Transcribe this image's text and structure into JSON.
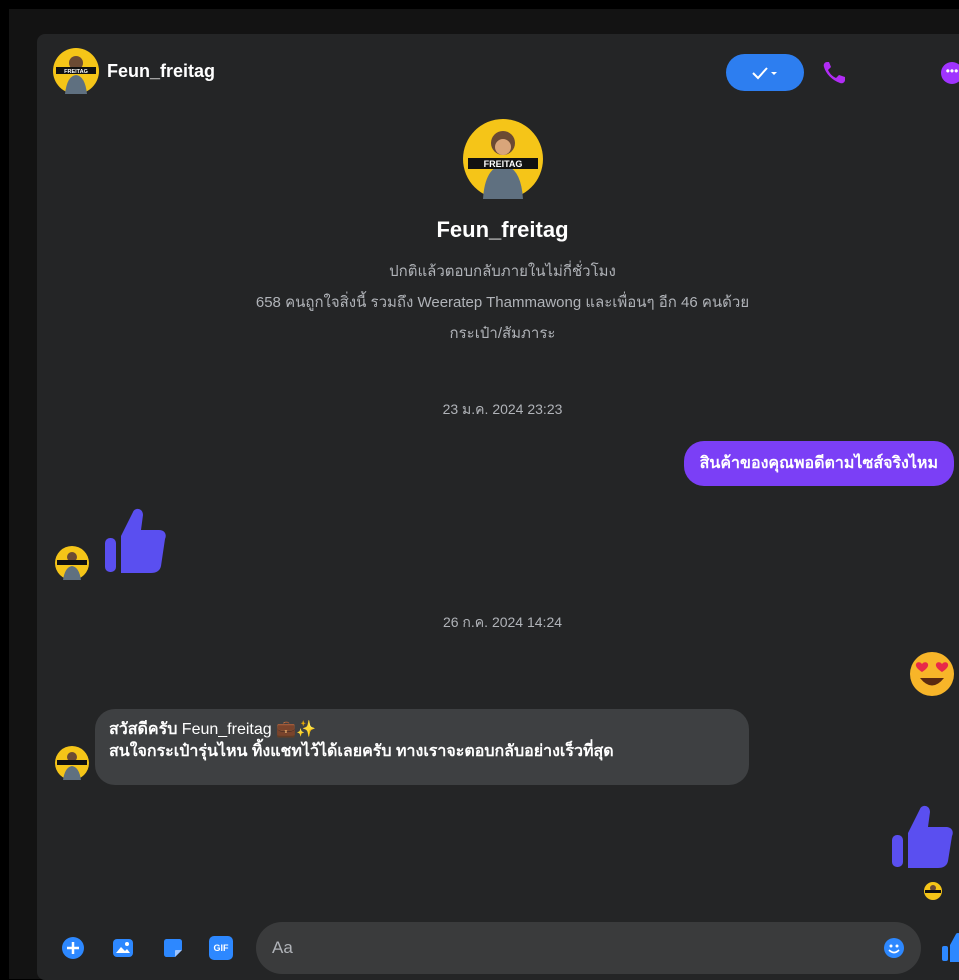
{
  "header": {
    "name": "Feun_freitag",
    "status_button_icon": "check-dropdown-icon",
    "status_button_label": "✓▾",
    "call_icon": "phone-icon",
    "more_icon": "more-icon"
  },
  "profile": {
    "name": "Feun_freitag",
    "response_note": "ปกติแล้วตอบกลับภายในไม่กี่ชั่วโมง",
    "likes_note": "658 คนถูกใจสิ่งนี้ รวมถึง Weeratep Thammawong และเพื่อนๆ อีก 46 คนด้วย",
    "category": "กระเป๋า/สัมภาระ",
    "avatar_text": "FREITAG"
  },
  "messages": {
    "timestamp_1": "23 ม.ค. 2024 23:23",
    "outgoing_1": "สินค้าของคุณพอดีตามไซส์จริงไหม",
    "timestamp_2": "26 ก.ค. 2024 14:24",
    "incoming_greeting_bold": "สวัสดีครับ",
    "incoming_greeting_rest": " Feun_freitag 💼✨",
    "incoming_line_2": "สนใจกระเป๋ารุ่นไหน ทิ้งแชทไว้ได้เลยครับ ทางเราจะตอบกลับอย่างเร็วที่สุด"
  },
  "composer": {
    "placeholder": "Aa",
    "icons": [
      "plus-icon",
      "image-icon",
      "sticker-icon",
      "gif-icon",
      "emoji-icon",
      "like-icon"
    ],
    "gif_label": "GIF"
  },
  "colors": {
    "accent_blue": "#2d7ef0",
    "accent_purple": "#7b3ff6",
    "thumb_blue": "#5a4ff0",
    "panel_bg": "#242526"
  }
}
